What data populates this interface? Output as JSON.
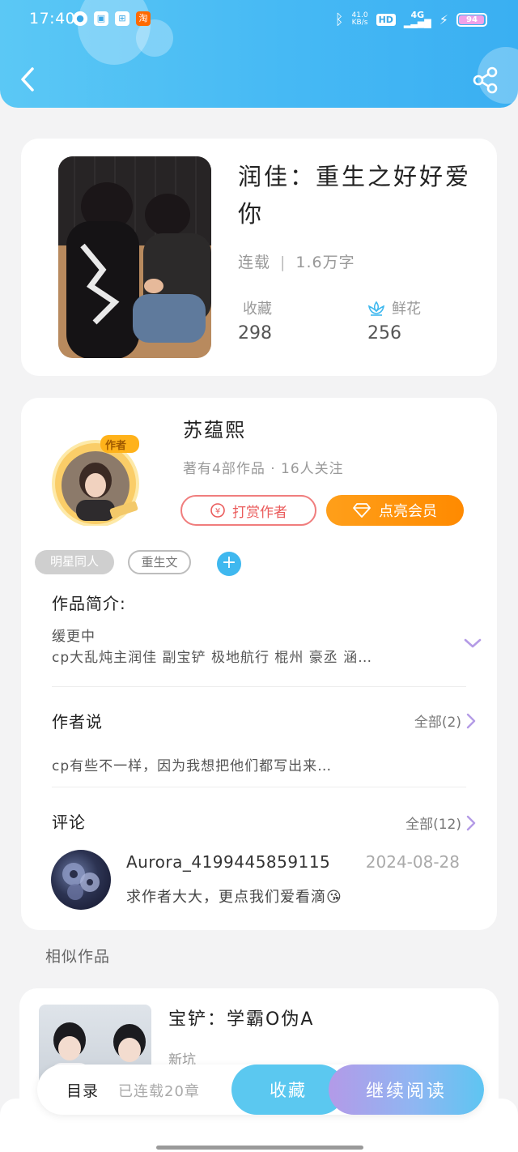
{
  "status_bar": {
    "time": "17:40",
    "net_speed_top": "41.0",
    "net_speed_bottom": "KB/s",
    "hd": "HD",
    "signal": "4G",
    "battery": "94"
  },
  "book": {
    "title": "润佳：重生之好好爱你",
    "status": "连载",
    "word_count": "1.6万字",
    "collect_label": "收藏",
    "collect_count": "298",
    "flower_label": "鲜花",
    "flower_count": "256"
  },
  "author": {
    "name": "苏蕴熙",
    "badge": "作者",
    "stats": "著有4部作品 · 16人关注",
    "reward_label": "打赏作者",
    "vip_label": "点亮会员"
  },
  "tags": [
    "明星同人",
    "重生文"
  ],
  "intro": {
    "title": "作品简介:",
    "line1": "缓更中",
    "line2": "cp大乱炖主润佳 副宝铲 极地航行 棍州 豪丞 涵…"
  },
  "author_say": {
    "title": "作者说",
    "more": "全部(2)",
    "text": "cp有些不一样，因为我想把他们都写出来…"
  },
  "comments": {
    "title": "评论",
    "more": "全部(12)",
    "items": [
      {
        "user": "Aurora_4199445859115",
        "date": "2024-08-28",
        "text": "求作者大大，更点我们爱看滴😘"
      }
    ]
  },
  "similar": {
    "title": "相似作品",
    "items": [
      {
        "title": "宝铲：学霸O伪A",
        "status": "新坑"
      }
    ]
  },
  "bottom_bar": {
    "toc_label": "目录",
    "chapters": "已连载20章",
    "collect_label": "收藏",
    "read_label": "继续阅读"
  },
  "colors": {
    "header": "#46b9f4",
    "accent_blue": "#3fb8ef",
    "vip_orange": "#ff8a00",
    "reward_red": "#ea5b5b",
    "chevron_purple": "#b49be6"
  }
}
